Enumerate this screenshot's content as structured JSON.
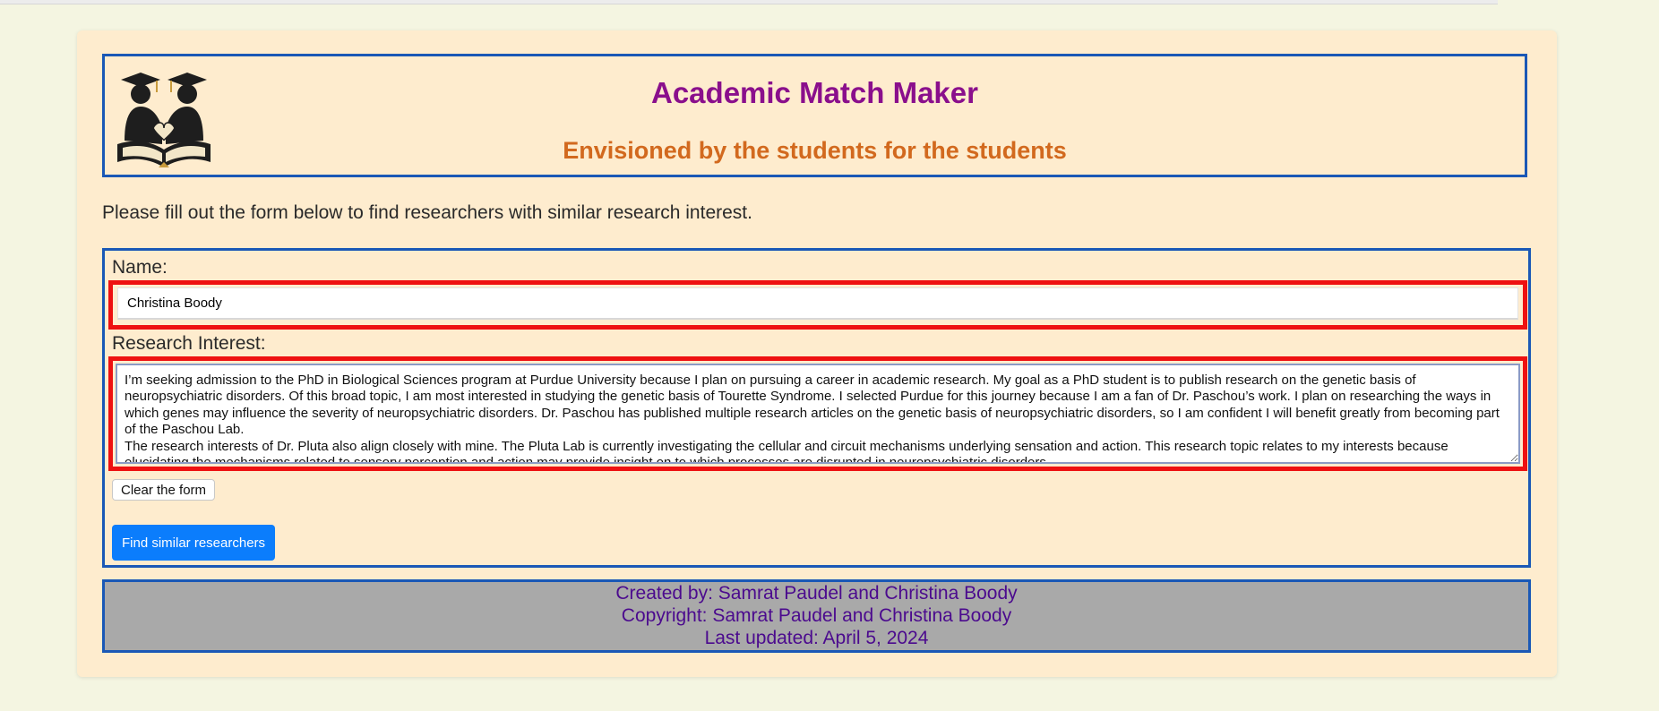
{
  "header": {
    "title": "Academic Match Maker",
    "subtitle": "Envisioned by the students for the students",
    "logo_icon": "graduates-handshake-book-logo"
  },
  "intro_text": "Please fill out the form below to find researchers with similar research interest.",
  "form": {
    "name_label": "Name:",
    "name_value": "Christina Boody",
    "interest_label": "Research Interest:",
    "interest_value": "I’m seeking admission to the PhD in Biological Sciences program at Purdue University because I plan on pursuing a career in academic research. My goal as a PhD student is to publish research on the genetic basis of neuropsychiatric disorders. Of this broad topic, I am most interested in studying the genetic basis of Tourette Syndrome. I selected Purdue for this journey because I am a fan of Dr. Paschou’s work. I plan on researching the ways in which genes may influence the severity of neuropsychiatric disorders. Dr. Paschou has published multiple research articles on the genetic basis of neuropsychiatric disorders, so I am confident I will benefit greatly from becoming part of the Paschou Lab.\nThe research interests of Dr. Pluta also align closely with mine. The Pluta Lab is currently investigating the cellular and circuit mechanisms underlying sensation and action. This research topic relates to my interests because elucidating the mechanisms related to sensory perception and action may provide insight on to which processes are disrupted in neuropsychiatric disorders.",
    "clear_button": "Clear the form",
    "submit_button": "Find similar researchers"
  },
  "footer": {
    "created_by": "Created by: Samrat Paudel and Christina Boody",
    "copyright": "Copyright: Samrat Paudel and Christina Boody",
    "last_updated": "Last updated: April 5, 2024"
  },
  "colors": {
    "page_background": "#f4f5e1",
    "card_background": "#feecce",
    "border_blue": "#1a58b6",
    "title_purple": "#8a0f8c",
    "subtitle_orange": "#d2691e",
    "highlight_red": "#ee1111",
    "button_blue": "#0b7dfc",
    "footer_gray": "#a9a9a9",
    "footer_text": "#4b0a8e"
  }
}
